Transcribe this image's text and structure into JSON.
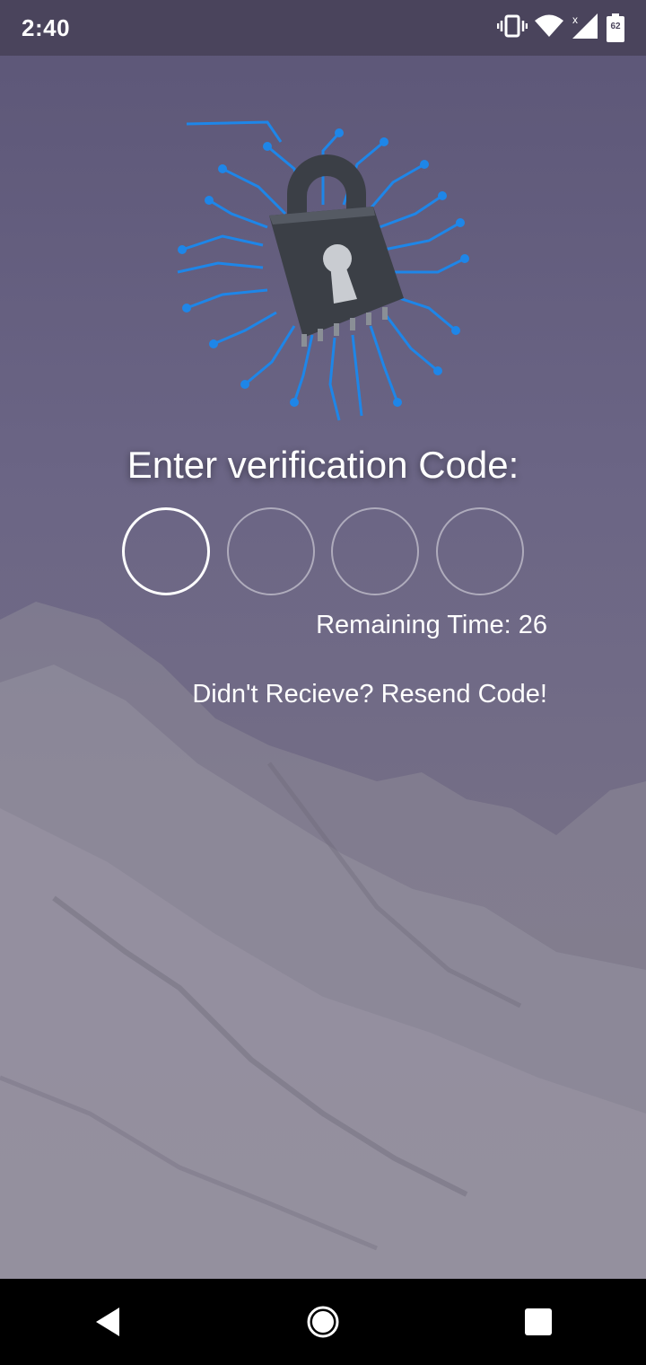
{
  "status_bar": {
    "time": "2:40",
    "battery_level": "62",
    "icons": [
      "vibrate-icon",
      "wifi-icon",
      "cell-signal-icon",
      "battery-icon"
    ]
  },
  "logo": {
    "icon": "lock-chip-icon",
    "lock_color": "#3b3f46",
    "circuit_color": "#1e86e8"
  },
  "verification": {
    "title": "Enter verification Code:",
    "digits": [
      "",
      "",
      "",
      ""
    ],
    "remaining_label": "Remaining Time: 26",
    "resend_label": "Didn't Recieve? Resend Code!"
  },
  "nav_bar": {
    "icons": [
      "back-icon",
      "home-icon",
      "recents-icon"
    ]
  }
}
